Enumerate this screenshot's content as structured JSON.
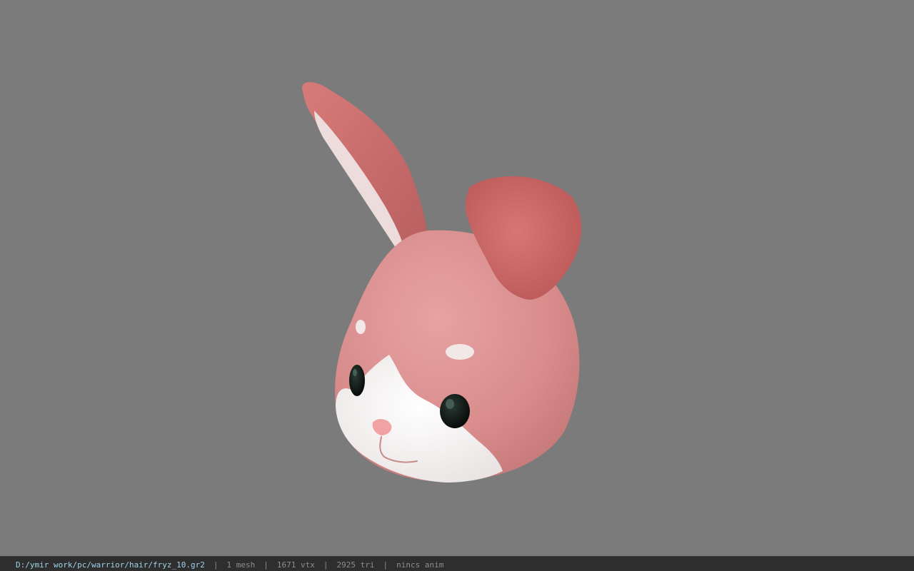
{
  "viewer": {
    "background_color": "#7b7b7b",
    "model": {
      "kind": "bunny-head",
      "fur_color": "#d98a8a",
      "ear_color": "#c96666",
      "inner_ear_color": "#e8d8d8",
      "face_white": "#f5f2f2",
      "nose_color": "#f0a0a0",
      "eye_color": "#0d1410"
    }
  },
  "statusbar": {
    "file_path": "D:/ymir work/pc/warrior/hair/fryz_10.gr2",
    "separator": "|",
    "mesh_count": "1 mesh",
    "vertex_count": "1671 vtx",
    "triangle_count": "2925 tri",
    "anim_status": "nincs anim"
  }
}
